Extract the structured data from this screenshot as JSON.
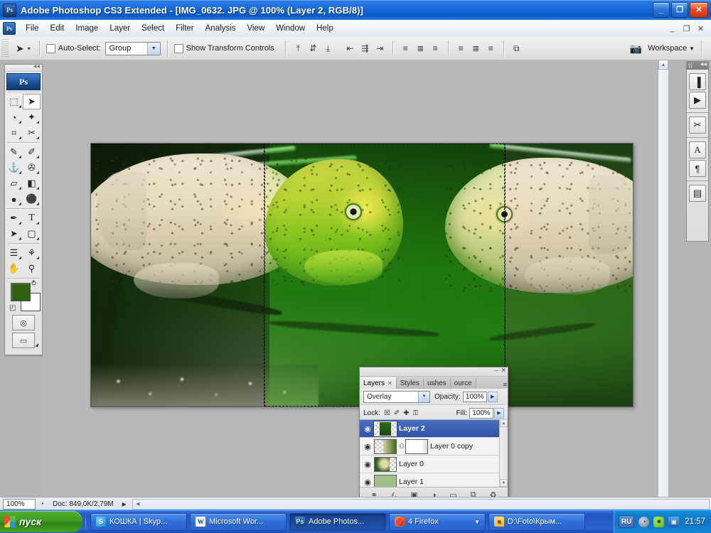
{
  "window": {
    "title": "Adobe Photoshop CS3 Extended - [IMG_0632. JPG @  100% (Layer 2, RGB/8)]",
    "app_icon": "Ps",
    "buttons": {
      "minimize": "_",
      "restore": "❐",
      "close": "✕"
    }
  },
  "menubar": {
    "doc_icon": "Ps",
    "items": [
      "File",
      "Edit",
      "Image",
      "Layer",
      "Select",
      "Filter",
      "Analysis",
      "View",
      "Window",
      "Help"
    ],
    "doc_buttons": {
      "minimize": "_",
      "restore": "❐",
      "close": "✕"
    }
  },
  "options_bar": {
    "tool_icon": "➤",
    "tool_preset_caret": "▾",
    "auto_select_label": "Auto-Select:",
    "auto_select_checked": false,
    "group_value": "Group",
    "group_caret": "▼",
    "show_transform_label": "Show Transform Controls",
    "show_transform_checked": false,
    "align_buttons": [
      "align-top-edges",
      "align-vertical-centers",
      "align-bottom-edges",
      "align-left-edges",
      "align-horizontal-centers",
      "align-right-edges"
    ],
    "align_glyphs": [
      "⤒",
      "⇵",
      "⤓",
      "⇤",
      "⇶",
      "⇥"
    ],
    "distribute_glyphs": [
      "≡",
      "≣",
      "≡"
    ],
    "more_glyph": "⧉",
    "camera_icon": "camera-icon",
    "workspace_label": "Workspace",
    "workspace_caret": "▼"
  },
  "toolbox": {
    "logo": "Ps",
    "tools": [
      {
        "name": "rectangular-marquee-tool",
        "glyph": "⬚",
        "selected": false
      },
      {
        "name": "move-tool",
        "glyph": "➤",
        "selected": true
      },
      {
        "name": "lasso-tool",
        "glyph": "◔",
        "selected": false
      },
      {
        "name": "magic-wand-tool",
        "glyph": "✦",
        "selected": false
      },
      {
        "name": "crop-tool",
        "glyph": "⌗",
        "selected": false
      },
      {
        "name": "slice-tool",
        "glyph": "✂",
        "selected": false
      },
      {
        "name": "healing-brush-tool",
        "glyph": "✎",
        "selected": false
      },
      {
        "name": "brush-tool",
        "glyph": "✐",
        "selected": false
      },
      {
        "name": "clone-stamp-tool",
        "glyph": "⚓",
        "selected": false
      },
      {
        "name": "history-brush-tool",
        "glyph": "✇",
        "selected": false
      },
      {
        "name": "eraser-tool",
        "glyph": "▱",
        "selected": false
      },
      {
        "name": "gradient-tool",
        "glyph": "◧",
        "selected": false
      },
      {
        "name": "blur-tool",
        "glyph": "●",
        "selected": false
      },
      {
        "name": "dodge-tool",
        "glyph": "⚫",
        "selected": false
      },
      {
        "name": "pen-tool",
        "glyph": "✒",
        "selected": false
      },
      {
        "name": "type-tool",
        "glyph": "T",
        "selected": false
      },
      {
        "name": "path-selection-tool",
        "glyph": "➤",
        "selected": false
      },
      {
        "name": "rectangle-tool",
        "glyph": "▢",
        "selected": false
      },
      {
        "name": "notes-tool",
        "glyph": "☰",
        "selected": false
      },
      {
        "name": "eyedropper-tool",
        "glyph": "⚘",
        "selected": false
      },
      {
        "name": "hand-tool",
        "glyph": "✋",
        "selected": false
      },
      {
        "name": "zoom-tool",
        "glyph": "⚲",
        "selected": false
      }
    ],
    "foreground_color": "#2e6112",
    "background_color": "#ffffff",
    "swap_icon": "⥁",
    "default_icon": "◰",
    "quickmask_icon": "◎",
    "screenmode_icon": "▭"
  },
  "right_dock": {
    "buttons": [
      {
        "name": "histogram-icon",
        "glyph": "▐"
      },
      {
        "name": "navigator-icon",
        "glyph": "▶"
      },
      {
        "name": "tool-presets-icon",
        "glyph": "✂"
      },
      {
        "name": "character-icon",
        "glyph": "A"
      },
      {
        "name": "paragraph-icon",
        "glyph": "¶"
      },
      {
        "name": "layer-comps-icon",
        "glyph": "▤"
      }
    ],
    "collapse_glyph": "◀◀"
  },
  "document": {
    "zoom": "100%",
    "scrollbar_up": "▲",
    "selection_name": "rectangular-selection-marquee"
  },
  "layers_panel": {
    "window_buttons": {
      "minimize": "–",
      "close": "✕"
    },
    "tabs": [
      {
        "label": "Layers",
        "active": true,
        "close": "✕"
      },
      {
        "label": "Styles",
        "active": false
      },
      {
        "label": "ushes",
        "active": false
      },
      {
        "label": "ource",
        "active": false
      }
    ],
    "panel_menu_glyph": "≡",
    "blend_mode": "Overlay",
    "blend_caret": "▼",
    "opacity_label": "Opacity:",
    "opacity_value": "100%",
    "fill_label": "Fill:",
    "fill_value": "100%",
    "stepper_caret": "▶",
    "lock_label": "Lock:",
    "lock_icons": [
      {
        "name": "lock-transparent-pixels-icon",
        "glyph": "☒"
      },
      {
        "name": "lock-image-pixels-icon",
        "glyph": "✐"
      },
      {
        "name": "lock-position-icon",
        "glyph": "✚"
      },
      {
        "name": "lock-all-icon",
        "glyph": "ὑ2"
      }
    ],
    "lock_glyphs": [
      "☒",
      "✐",
      "✚",
      "⚿"
    ],
    "layers": [
      {
        "name": "Layer 2",
        "selected": true,
        "visible": true,
        "eye": "◉",
        "has_mask": false,
        "thumb_style": "green-band"
      },
      {
        "name": "Layer 0 copy",
        "selected": false,
        "visible": true,
        "eye": "◉",
        "has_mask": true,
        "link": "⧉",
        "thumb_style": "fish-partial"
      },
      {
        "name": "Layer 0",
        "selected": false,
        "visible": true,
        "eye": "◉",
        "has_mask": false,
        "thumb_style": "fish-full"
      },
      {
        "name": "Layer 1",
        "selected": false,
        "visible": true,
        "eye": "◉",
        "has_mask": false,
        "thumb_style": "solid-green"
      }
    ],
    "scroll_up": "▲",
    "scroll_down": "▼",
    "footer_buttons": [
      {
        "name": "link-layers-button",
        "glyph": "⚭"
      },
      {
        "name": "layer-style-button",
        "glyph": "ƒₓ"
      },
      {
        "name": "layer-mask-button",
        "glyph": "▣"
      },
      {
        "name": "adjustment-layer-button",
        "glyph": "◑"
      },
      {
        "name": "new-group-button",
        "glyph": "▭"
      },
      {
        "name": "new-layer-button",
        "glyph": "❐"
      },
      {
        "name": "delete-layer-button",
        "glyph": "Ὕ1"
      }
    ],
    "footer_glyphs": [
      "⚭",
      "ƒₓ",
      "▣",
      "◑",
      "▭",
      "⧉",
      "♻"
    ]
  },
  "status_bar": {
    "zoom": "100%",
    "preview_icon": "◔",
    "doc_info": "Doc: 849,0K/2,79M",
    "arrow": "▶",
    "scroll_left": "◀"
  },
  "taskbar": {
    "start_label": "пуск",
    "buttons": [
      {
        "label": "КОШКА | Skyp...",
        "icon": "skype-icon",
        "icon_glyph": "S",
        "active": false
      },
      {
        "label": "Microsoft Wor...",
        "icon": "word-icon",
        "icon_glyph": "W",
        "active": false
      },
      {
        "label": "Adobe Photos...",
        "icon": "photoshop-icon",
        "icon_glyph": "Ps",
        "active": true
      },
      {
        "label": "4 Firefox",
        "icon": "firefox-icon",
        "icon_glyph": "●",
        "active": false,
        "caret": "▼"
      },
      {
        "label": "D:\\Foto\\Крым...",
        "icon": "folder-icon",
        "icon_glyph": "■",
        "active": false
      }
    ],
    "language": "RU",
    "tray_icons": [
      {
        "name": "security-shield-icon",
        "glyph": "◔"
      },
      {
        "name": "antivirus-icon",
        "glyph": "✸"
      },
      {
        "name": "network-icon",
        "glyph": "▣"
      }
    ],
    "clock": "21:57"
  }
}
